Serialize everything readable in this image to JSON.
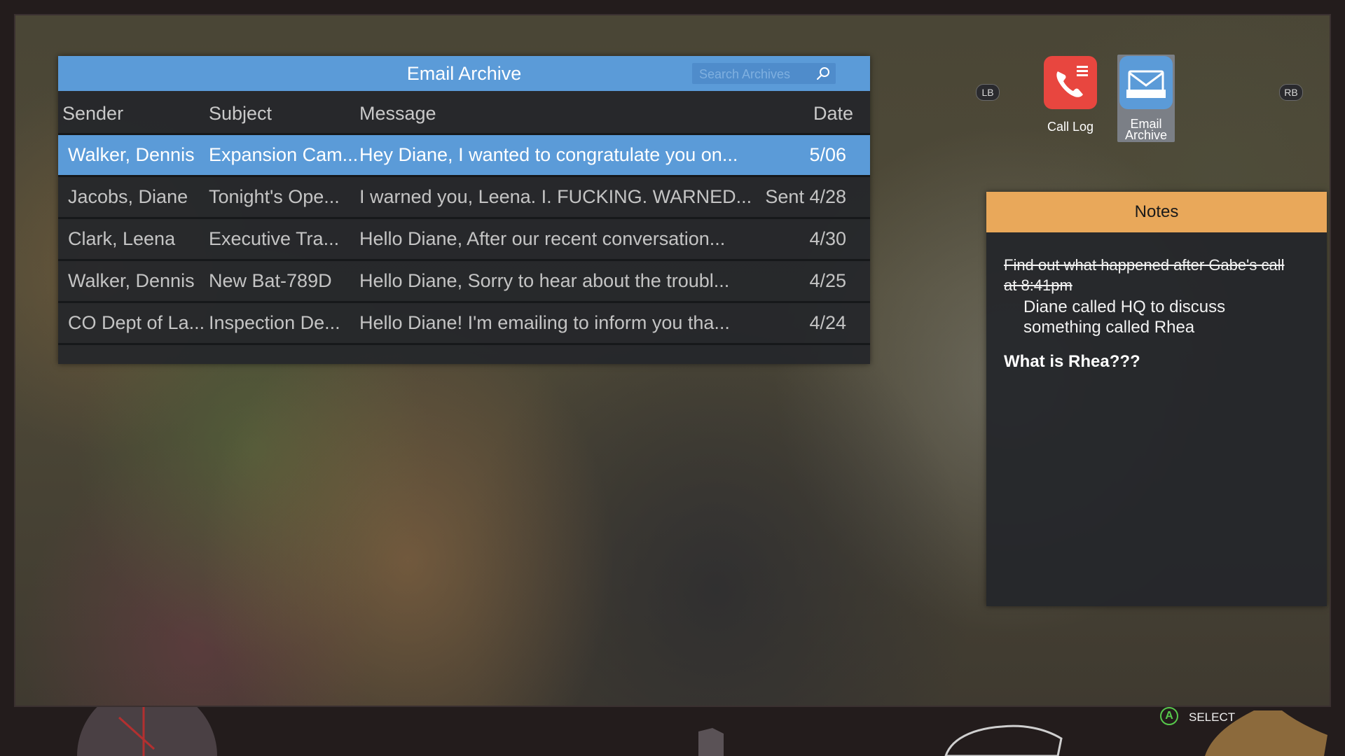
{
  "email_archive": {
    "title": "Email Archive",
    "search_placeholder": "Search Archives",
    "columns": {
      "sender": "Sender",
      "subject": "Subject",
      "message": "Message",
      "date": "Date"
    },
    "rows": [
      {
        "sender": "Walker, Dennis",
        "subject": "Expansion Cam...",
        "message": "Hey Diane, I wanted to congratulate you on...",
        "date": "5/06",
        "selected": true
      },
      {
        "sender": "Jacobs, Diane",
        "subject": "Tonight's Ope...",
        "message": "I warned you, Leena. I. FUCKING. WARNED...",
        "date": "Sent 4/28",
        "selected": false
      },
      {
        "sender": "Clark, Leena",
        "subject": "Executive Tra...",
        "message": "Hello Diane, After our recent conversation...",
        "date": "4/30",
        "selected": false
      },
      {
        "sender": "Walker, Dennis",
        "subject": "New Bat-789D",
        "message": "Hello Diane, Sorry to hear about the troubl...",
        "date": "4/25",
        "selected": false
      },
      {
        "sender": "CO Dept of La...",
        "subject": "Inspection De...",
        "message": "Hello Diane! I'm emailing to inform you tha...",
        "date": "4/24",
        "selected": false
      }
    ]
  },
  "apps": {
    "lb_label": "LB",
    "rb_label": "RB",
    "call_log": {
      "label": "Call Log",
      "icon": "phone-icon",
      "color": "#e8463f"
    },
    "email_archive": {
      "label_line1": "Email",
      "label_line2": "Archive",
      "icon": "envelope-icon",
      "color": "#5b9bd8",
      "active": true
    }
  },
  "notes": {
    "title": "Notes",
    "struck_item": "Find out what happened after Gabe's call at 8:41pm",
    "sub_item": "Diane called HQ to discuss something called Rhea",
    "question": "What is Rhea???"
  },
  "footer": {
    "button": "A",
    "action": "SELECT"
  },
  "colors": {
    "accent_blue": "#5b9bd8",
    "notes_orange": "#e9a85a",
    "call_red": "#e8463f",
    "a_button_green": "#57c84b"
  }
}
